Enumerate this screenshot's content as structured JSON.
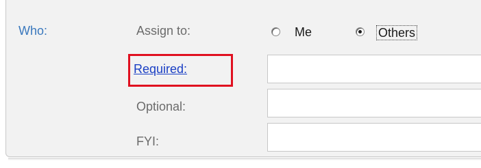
{
  "who": {
    "label": "Who:"
  },
  "assign": {
    "label": "Assign to:",
    "options": [
      {
        "label": "Me",
        "checked": false
      },
      {
        "label": "Others",
        "checked": true
      }
    ]
  },
  "fields": {
    "required": {
      "label": "Required:",
      "value": "",
      "is_link": true,
      "highlight_color": "#e01020"
    },
    "optional": {
      "label": "Optional:",
      "value": ""
    },
    "fyi": {
      "label": "FYI:",
      "value": ""
    }
  },
  "colors": {
    "section_label": "#3a78bd",
    "link": "#1a3fc4",
    "panel_bg": "#f2f2f2"
  }
}
